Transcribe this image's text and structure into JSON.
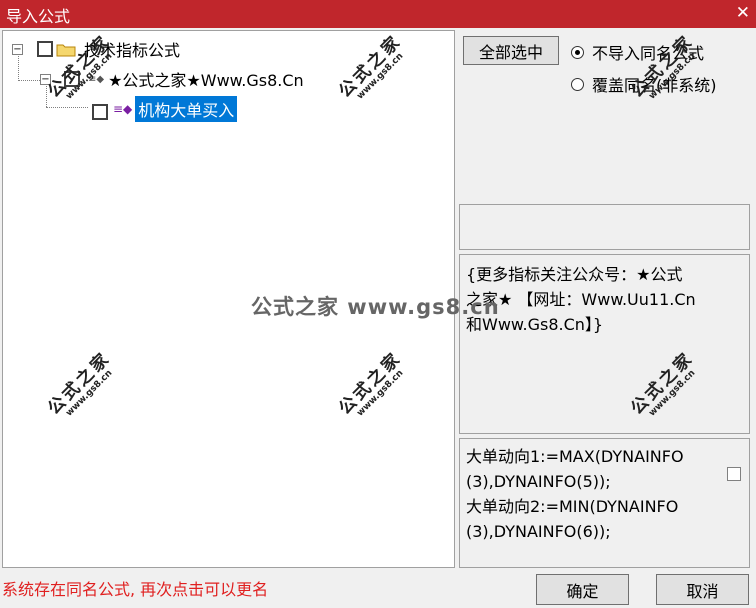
{
  "window": {
    "title": "导入公式",
    "close_glyph": "✕"
  },
  "tree": {
    "root": {
      "label": "技术指标公式",
      "expander": "−"
    },
    "group": {
      "label": "★公式之家★Www.Gs8.Cn",
      "expander": "−"
    },
    "leaf": {
      "label": "机构大单买入"
    }
  },
  "options": {
    "select_all_label": "全部选中",
    "radio_no_import_label": "不导入同名公式",
    "radio_overwrite_label": "覆盖同名(非系统)"
  },
  "info": {
    "lines": [
      "{更多指标关注公众号：★公式",
      "之家★ 【网址：Www.Uu11.Cn",
      "和Www.Gs8.Cn】}"
    ]
  },
  "code": {
    "lines": [
      "大单动向1:=MAX(DYNAINFO",
      "(3),DYNAINFO(5));",
      "大单动向2:=MIN(DYNAINFO",
      "(3),DYNAINFO(6));"
    ]
  },
  "status": {
    "message": "系统存在同名公式, 再次点击可以更名"
  },
  "buttons": {
    "ok_label": "确定",
    "cancel_label": "取消"
  },
  "watermark": {
    "big": "公式之家",
    "small": "www.gs8.cn",
    "center": "公式之家 www.gs8.cn"
  },
  "colors": {
    "titlebar": "#c0262c",
    "selection": "#0078d7",
    "status": "#e02020"
  }
}
